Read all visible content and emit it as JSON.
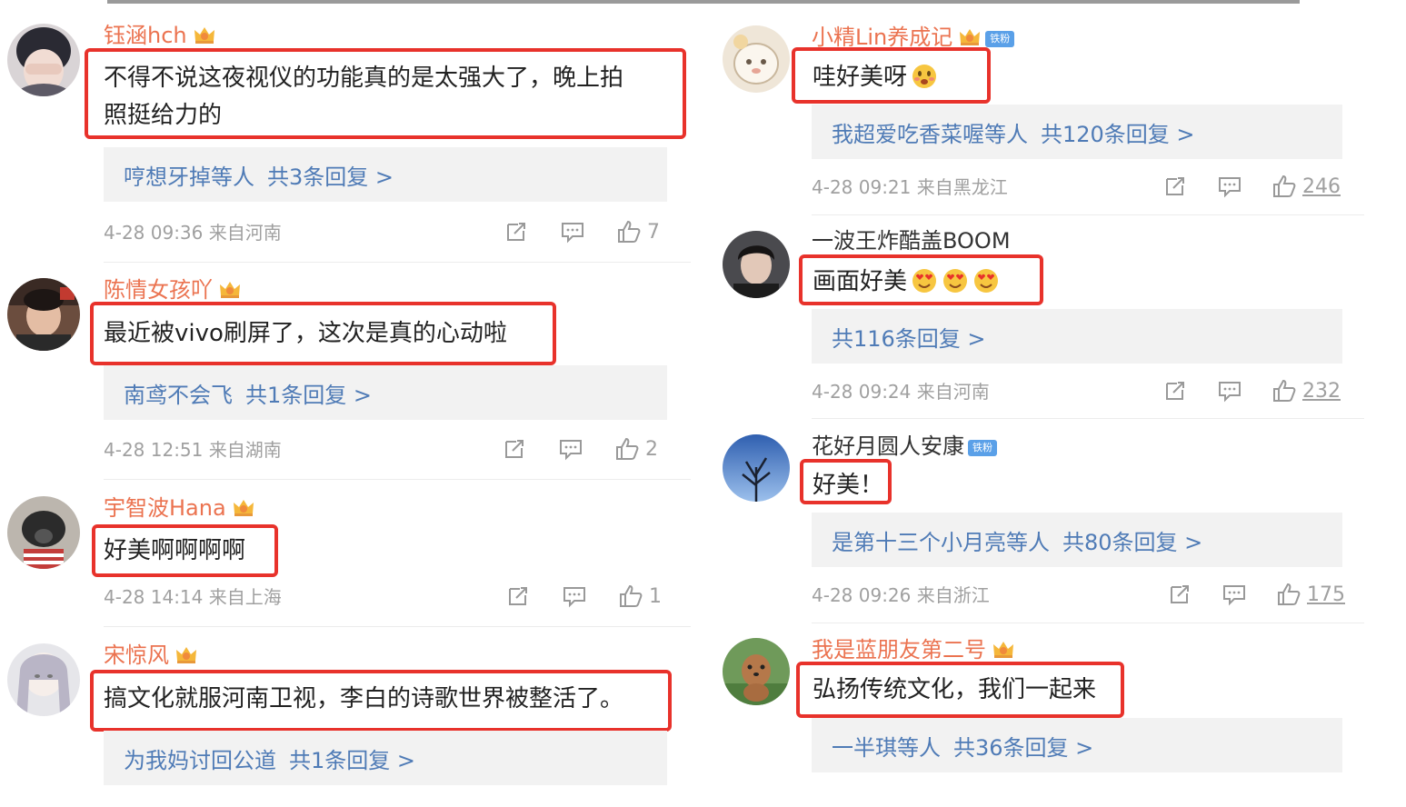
{
  "left": [
    {
      "username": "钰涵hch",
      "text_lines": [
        "不得不说这夜视仪的功能真的是太强大了，晚上拍",
        "照挺给力的"
      ],
      "reply_users": "哼想牙掉等人",
      "reply_count": "共3条回复 >",
      "meta": "4-28 09:36  来自河南",
      "likes": "7"
    },
    {
      "username": "陈情女孩吖",
      "text_lines": [
        "最近被vivo刷屏了，这次是真的心动啦"
      ],
      "reply_users": "南鸢不会飞",
      "reply_count": "共1条回复 >",
      "meta": "4-28 12:51  来自湖南",
      "likes": "2"
    },
    {
      "username": "宇智波Hana",
      "text_lines": [
        "好美啊啊啊啊"
      ],
      "meta": "4-28 14:14  来自上海",
      "likes": "1"
    },
    {
      "username": "宋惊风",
      "text_lines": [
        "搞文化就服河南卫视，李白的诗歌世界被整活了。"
      ],
      "reply_users": "为我妈讨回公道",
      "reply_count": "共1条回复 >"
    }
  ],
  "right": [
    {
      "username": "小精Lin养成记",
      "badge": "铁粉",
      "text": "哇好美呀",
      "reply_users": "我超爱吃香菜喔等人",
      "reply_count": "共120条回复 >",
      "meta": "4-28 09:21  来自黑龙江",
      "likes": "246"
    },
    {
      "username": "一波王炸酷盖BOOM",
      "text": "画面好美",
      "reply_count": "共116条回复 >",
      "meta": "4-28 09:24  来自河南",
      "likes": "232"
    },
    {
      "username": "花好月圆人安康",
      "badge": "铁粉",
      "text": "好美！",
      "reply_users": "是第十三个小月亮等人",
      "reply_count": "共80条回复 >",
      "meta": "4-28 09:26  来自浙江",
      "likes": "175"
    },
    {
      "username": "我是蓝朋友第二号",
      "text": "弘扬传统文化，我们一起来",
      "reply_users": "一半琪等人",
      "reply_count": "共36条回复 >"
    }
  ],
  "colors": {
    "username_orange": "#eb7350",
    "link_blue": "#4f7bb6",
    "highlight_red": "#e8322b",
    "meta_gray": "#a0a0a0"
  },
  "icons": [
    "repost-icon",
    "comment-icon",
    "like-icon",
    "crown-icon",
    "emoji-icon"
  ]
}
